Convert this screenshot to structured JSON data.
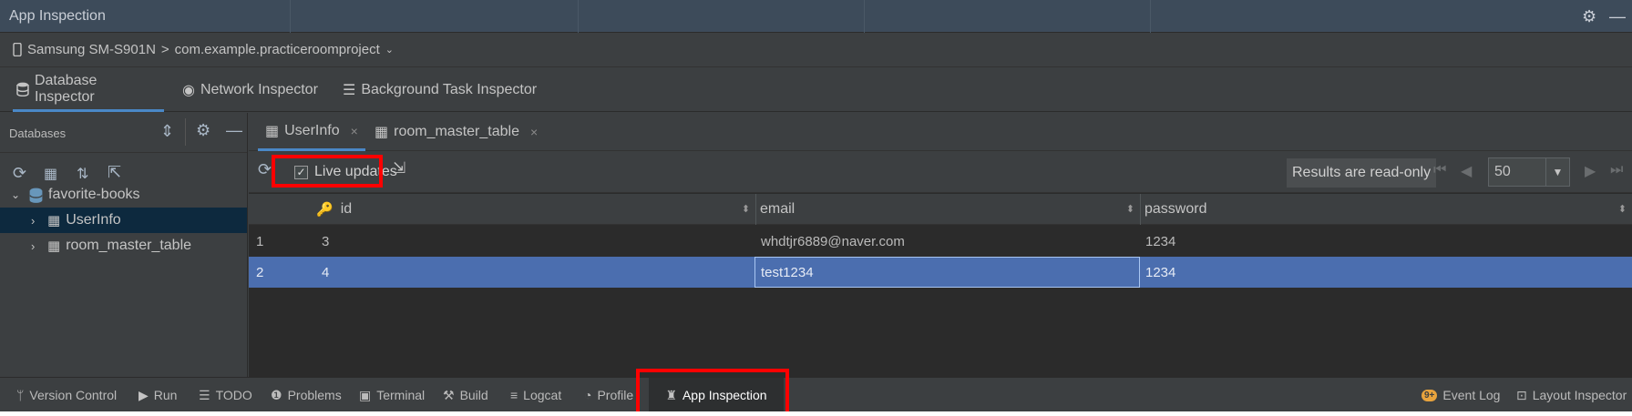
{
  "window": {
    "title": "App Inspection"
  },
  "device": {
    "name": "Samsung SM-S901N",
    "separator": ">",
    "process": "com.example.practiceroomproject"
  },
  "inspector_tabs": [
    {
      "label": "Database Inspector",
      "active": true,
      "icon": "database-icon"
    },
    {
      "label": "Network Inspector",
      "active": false,
      "icon": "globe-icon"
    },
    {
      "label": "Background Task Inspector",
      "active": false,
      "icon": "list-icon"
    }
  ],
  "left_panel": {
    "title": "Databases",
    "database": "favorite-books",
    "tables": [
      "UserInfo",
      "room_master_table"
    ],
    "selected_table": "UserInfo"
  },
  "table_tabs": [
    {
      "label": "UserInfo",
      "active": true,
      "close": "×"
    },
    {
      "label": "room_master_table",
      "active": false,
      "close": "×"
    }
  ],
  "table_toolbar": {
    "live_updates_label": "Live updates",
    "live_updates_checked": true,
    "read_only_label": "Results are read-only",
    "page_size": "50"
  },
  "grid": {
    "columns": [
      "id",
      "email",
      "password"
    ],
    "rows": [
      {
        "num": "1",
        "id": "3",
        "email": "whdtjr6889@naver.com",
        "password": "1234",
        "selected": false
      },
      {
        "num": "2",
        "id": "4",
        "email": "test1234",
        "password": "1234",
        "selected": true
      }
    ]
  },
  "bottom_toolbar": {
    "left": [
      {
        "label": "Version Control",
        "icon": "branch-icon"
      },
      {
        "label": "Run",
        "icon": "play-icon"
      },
      {
        "label": "TODO",
        "icon": "list-icon"
      },
      {
        "label": "Problems",
        "icon": "warning-icon"
      },
      {
        "label": "Terminal",
        "icon": "terminal-icon"
      },
      {
        "label": "Build",
        "icon": "hammer-icon"
      },
      {
        "label": "Logcat",
        "icon": "logcat-icon"
      },
      {
        "label": "Profile",
        "icon": "gauge-icon"
      },
      {
        "label": "App Inspection",
        "icon": "inspector-icon",
        "active": true
      }
    ],
    "right": [
      {
        "label": "Event Log",
        "badge": "9+"
      },
      {
        "label": "Layout Inspector",
        "icon": "layout-inspector-icon"
      }
    ]
  },
  "colors": {
    "accent": "#4a88c7",
    "selection": "#4b6eaf",
    "highlight_box": "#ff0000"
  }
}
